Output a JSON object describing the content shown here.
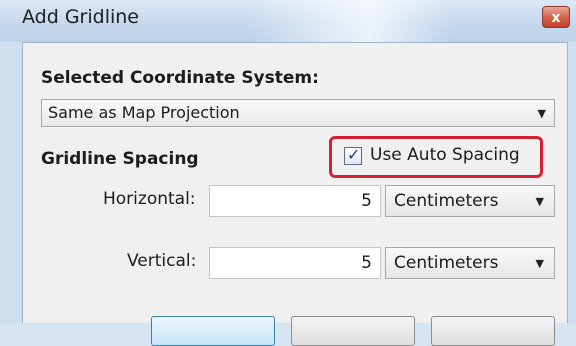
{
  "window": {
    "title": "Add Gridline",
    "close_glyph": "x"
  },
  "coordinate_system": {
    "label": "Selected Coordinate System:",
    "selected": "Same as Map Projection"
  },
  "spacing": {
    "heading": "Gridline Spacing",
    "auto_spacing_label": "Use Auto Spacing",
    "auto_spacing_checked": true,
    "horizontal": {
      "label": "Horizontal:",
      "value": "5",
      "unit": "Centimeters"
    },
    "vertical": {
      "label": "Vertical:",
      "value": "5",
      "unit": "Centimeters"
    }
  },
  "colors": {
    "highlight": "#d42030",
    "title_bar": "#c6d9ee",
    "client_bg": "#f0f0f0"
  }
}
